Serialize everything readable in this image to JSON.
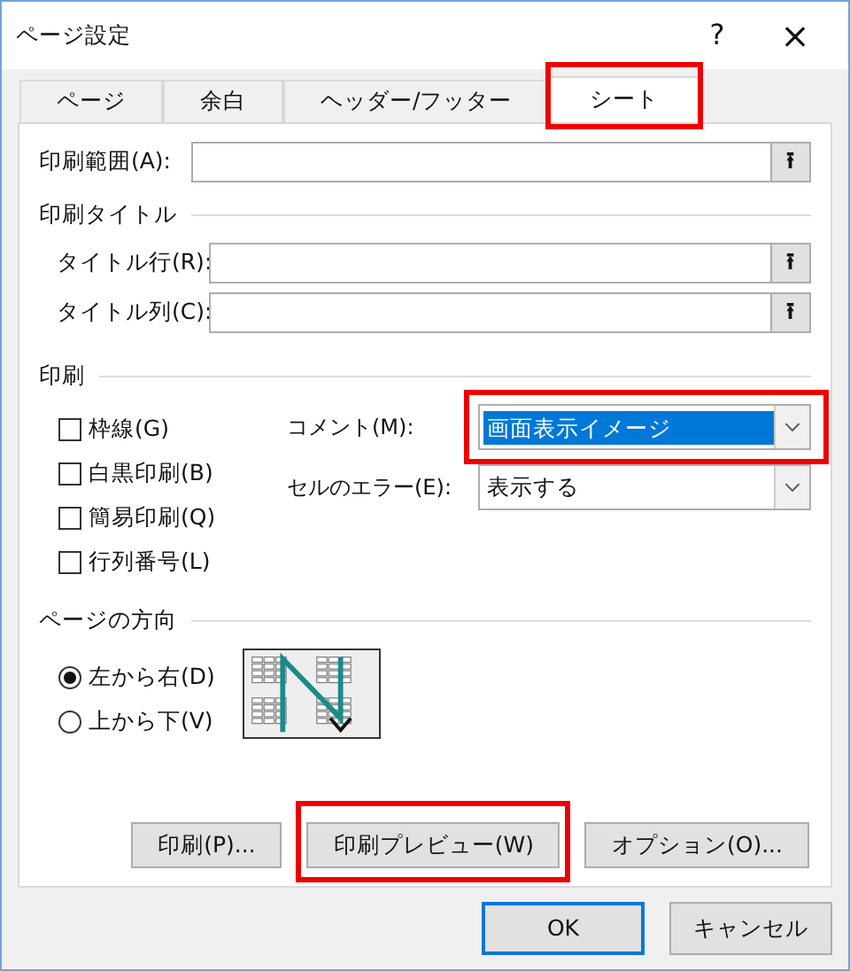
{
  "window": {
    "title": "ページ設定",
    "help": "?",
    "close": "×"
  },
  "tabs": [
    {
      "label": "ページ",
      "selected": false,
      "highlighted": false
    },
    {
      "label": "余白",
      "selected": false,
      "highlighted": false
    },
    {
      "label": "ヘッダー/フッター",
      "selected": false,
      "highlighted": false
    },
    {
      "label": "シート",
      "selected": true,
      "highlighted": true
    }
  ],
  "print_area": {
    "label": "印刷範囲(A):",
    "button": "⭱"
  },
  "print_titles": {
    "heading": "印刷タイトル",
    "fields": [
      {
        "label": "タイトル行(R):",
        "button": "⭱"
      },
      {
        "label": "タイトル列(C):",
        "button": "⭱"
      }
    ]
  },
  "print": {
    "heading": "印刷",
    "checkboxes": [
      {
        "label": "枠線(G)",
        "checked": false
      },
      {
        "label": "白黒印刷(B)",
        "checked": false
      },
      {
        "label": "簡易印刷(Q)",
        "checked": false
      },
      {
        "label": "行列番号(L)",
        "checked": false
      }
    ],
    "dropdowns": [
      {
        "label": "コメント(M):",
        "value": "画面表示イメージ",
        "focused": true,
        "highlighted": true
      },
      {
        "label": "セルのエラー(E):",
        "value": "表示する",
        "focused": false,
        "highlighted": false
      }
    ]
  },
  "page_order": {
    "heading": "ページの方向",
    "options": [
      {
        "label": "左から右(D)",
        "selected": true
      },
      {
        "label": "上から下(V)",
        "selected": false
      }
    ]
  },
  "action_buttons": [
    {
      "label": "印刷(P)...",
      "highlighted": false
    },
    {
      "label": "印刷プレビュー(W)",
      "highlighted": true
    },
    {
      "label": "オプション(O)...",
      "highlighted": false
    }
  ],
  "footer_buttons": [
    {
      "label": "OK",
      "default": true
    },
    {
      "label": "キャンセル",
      "default": false
    }
  ]
}
